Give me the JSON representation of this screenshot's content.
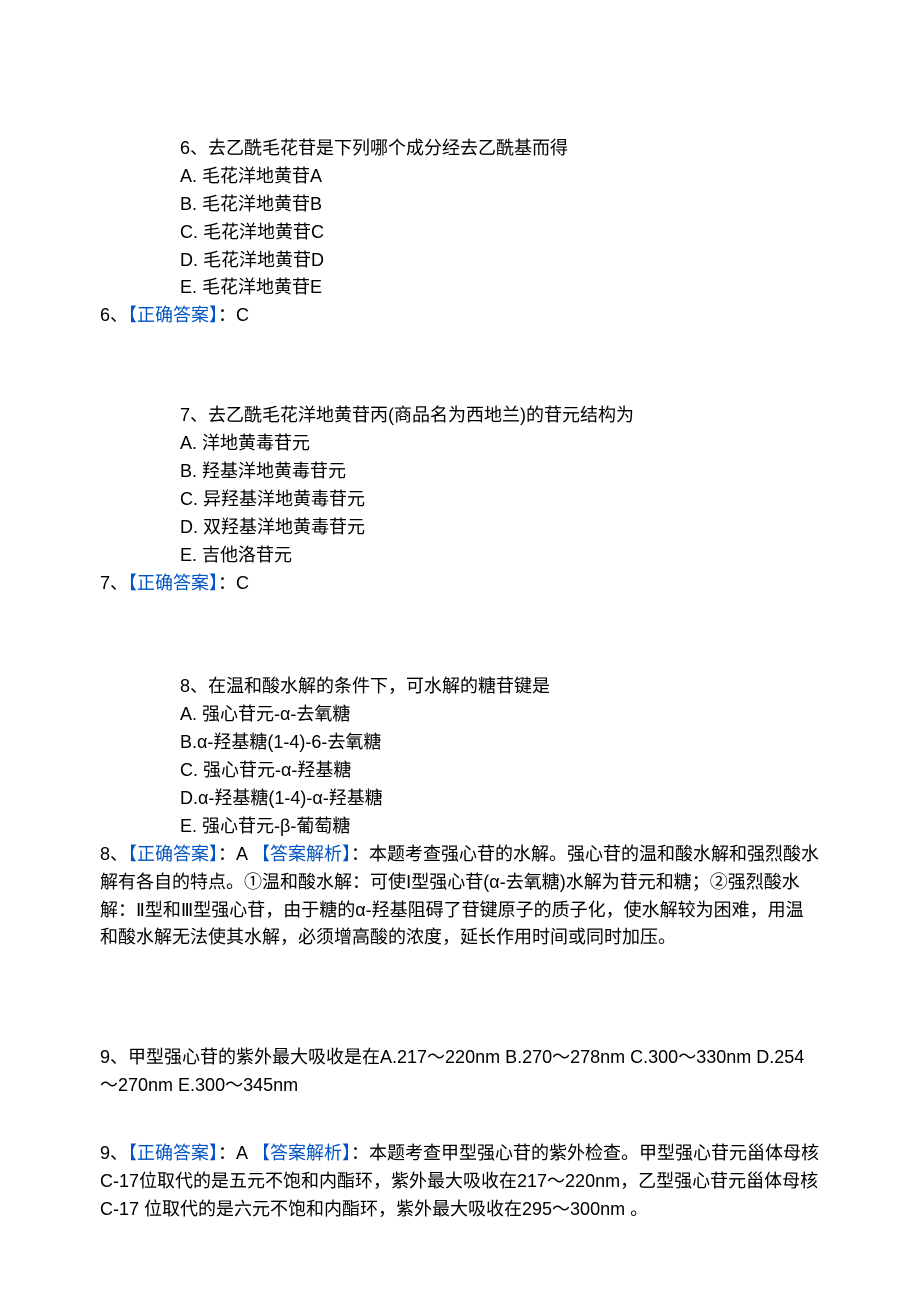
{
  "q6": {
    "stem": "6、去乙酰毛花苷是下列哪个成分经去乙酰基而得",
    "opts": [
      "A.  毛花洋地黄苷A",
      "B.  毛花洋地黄苷B",
      "C.  毛花洋地黄苷C",
      "D.  毛花洋地黄苷D",
      "E.  毛花洋地黄苷E"
    ],
    "ans_prefix": "6、",
    "ans_label": "【正确答案】",
    "ans_value": "：C"
  },
  "q7": {
    "stem": "7、去乙酰毛花洋地黄苷丙(商品名为西地兰)的苷元结构为",
    "opts": [
      "A.  洋地黄毒苷元",
      "B.  羟基洋地黄毒苷元",
      "C.  异羟基洋地黄毒苷元",
      "D.  双羟基洋地黄毒苷元",
      "E.  吉他洛苷元"
    ],
    "ans_prefix": "7、",
    "ans_label": "【正确答案】",
    "ans_value": "：C"
  },
  "q8": {
    "stem": "8、在温和酸水解的条件下，可水解的糖苷键是",
    "opts": [
      "A.   强心苷元-α-去氧糖",
      "B.α-羟基糖(1-4)-6-去氧糖",
      "C.   强心苷元-α-羟基糖",
      "D.α-羟基糖(1-4)-α-羟基糖",
      "E.   强心苷元-β-葡萄糖"
    ],
    "ans_prefix": "8、",
    "ans_label1": "【正确答案】",
    "ans_mid": "：A  ",
    "ans_label2": "【答案解析】",
    "ans_expl": "：本题考查强心苷的水解。强心苷的温和酸水解和强烈酸水解有各自的特点。①温和酸水解：可使Ⅰ型强心苷(α-去氧糖)水解为苷元和糖；②强烈酸水解：Ⅱ型和Ⅲ型强心苷，由于糖的α-羟基阻碍了苷键原子的质子化，使水解较为困难，用温和酸水解无法使其水解，必须增高酸的浓度，延长作用时间或同时加压。"
  },
  "q9": {
    "stem": "9、甲型强心苷的紫外最大吸收是在A.217～220nm  B.270～278nm  C.300～330nm  D.254～270nm  E.300～345nm",
    "ans_prefix": "9、",
    "ans_label1": "【正确答案】",
    "ans_mid": "：A  ",
    "ans_label2": "【答案解析】",
    "ans_expl": "：本题考查甲型强心苷的紫外检查。甲型强心苷元甾体母核C-17位取代的是五元不饱和内酯环，紫外最大吸收在217～220nm，乙型强心苷元甾体母核C-17 位取代的是六元不饱和内酯环，紫外最大吸收在295～300nm 。"
  }
}
